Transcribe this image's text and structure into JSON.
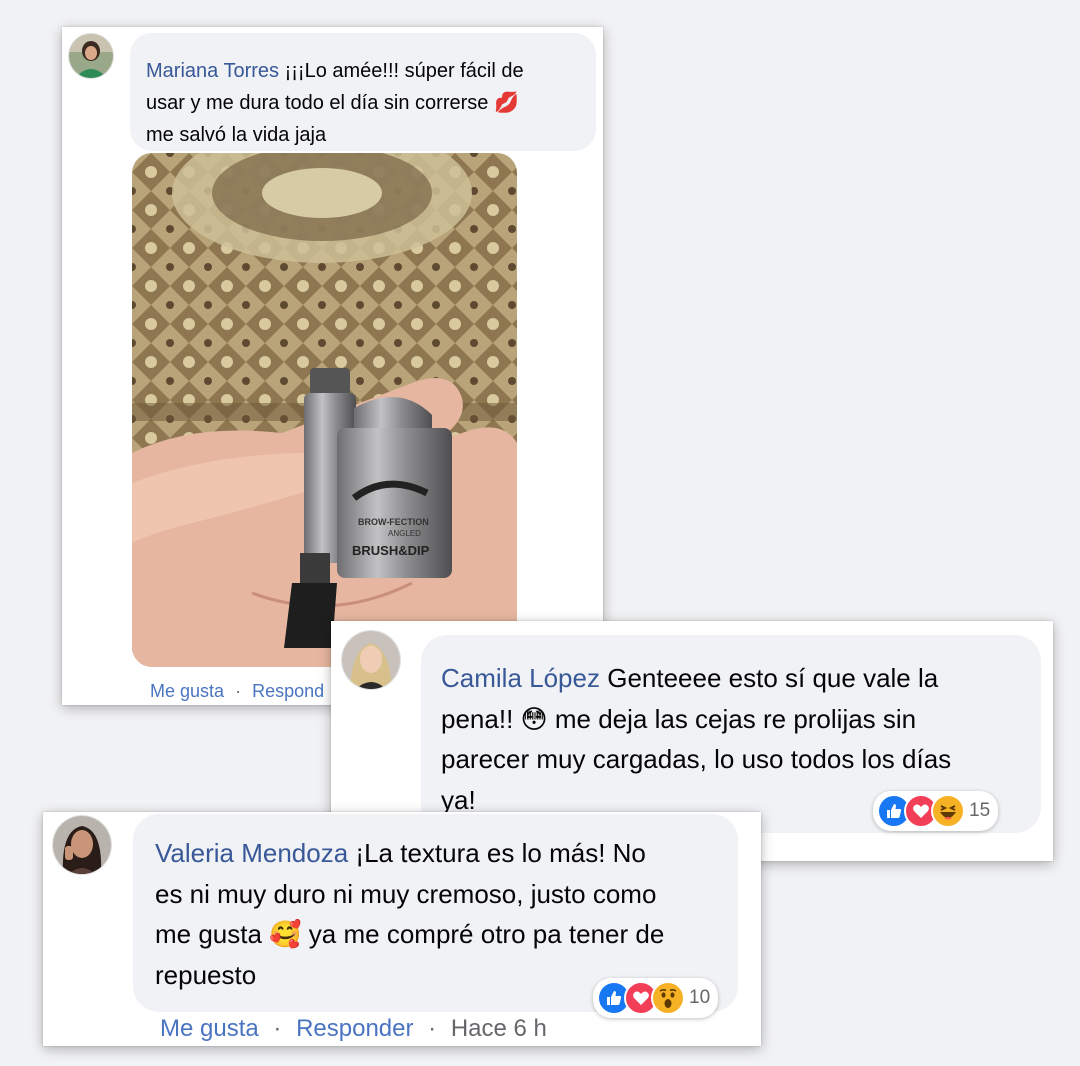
{
  "comments": [
    {
      "author": "Mariana Torres",
      "text": "¡¡¡Lo amée!!! súper fácil de usar y me dura todo el día sin correrse 💋 me salvó la vida jaja",
      "line1": "¡¡¡Lo amée!!! súper fácil de",
      "line2": "usar y me dura todo el día sin correrse",
      "line2_emoji": "💋",
      "line3": "me salvó la vida jaja",
      "photo_text": {
        "line1": "BROW-FECTION",
        "line2": "ANGLED",
        "line3": "BRUSH&DIP"
      },
      "actions": {
        "like": "Me gusta",
        "separator": "·",
        "reply": "Respond"
      }
    },
    {
      "author": "Camila López",
      "line1": "Genteeee esto sí que vale la",
      "line2a": "pena!!",
      "line2_emoji": "😳",
      "line2b": "me deja las cejas re prolijas sin",
      "line3": "parecer muy cargadas, lo uso todos los días",
      "line4": "ya!",
      "reactions": {
        "icons": [
          "like-icon",
          "love-icon",
          "haha-icon"
        ],
        "count": "15"
      }
    },
    {
      "author": "Valeria Mendoza",
      "line1": "¡La textura es lo más! No",
      "line2": "es ni muy duro ni muy cremoso, justo como",
      "line3a": "me gusta",
      "line3_emoji": "🥰",
      "line3b": "ya me compré otro pa tener de",
      "line4": "repuesto",
      "reactions": {
        "icons": [
          "like-icon",
          "love-icon",
          "wow-icon"
        ],
        "count": "10"
      },
      "actions": {
        "like": "Me gusta",
        "separator": "·",
        "reply": "Responder",
        "time": "Hace 6 h"
      }
    }
  ],
  "colors": {
    "name": "#385898",
    "action": "#4a74c2",
    "bubble": "#f0f2f5",
    "like": "#1877f2",
    "love": "#f33e58",
    "emoji_yellow": "#f7b125"
  }
}
